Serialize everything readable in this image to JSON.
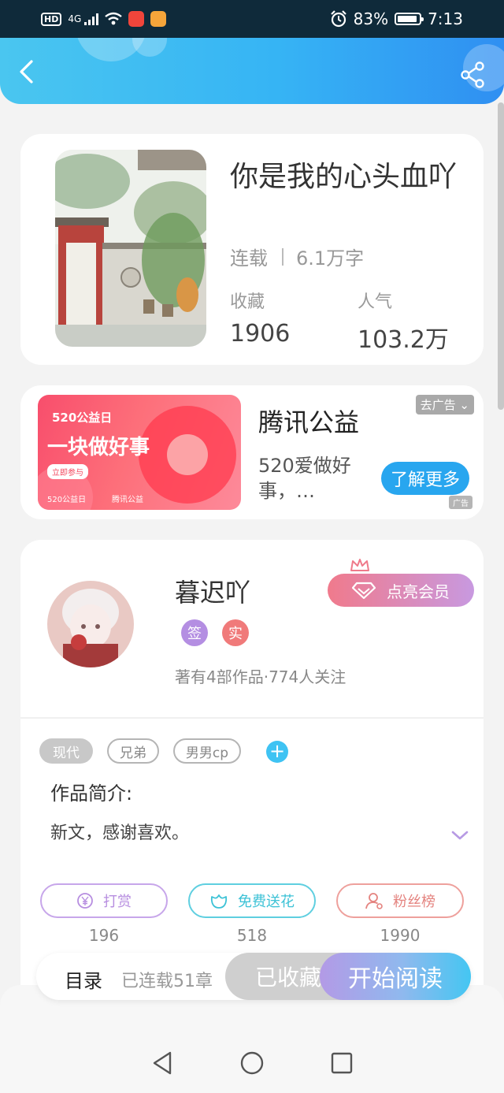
{
  "status_bar": {
    "network": "4G",
    "battery": "83%",
    "time": "7:13"
  },
  "book": {
    "title": "你是我的心头血吖",
    "status": "连载",
    "word_count": "6.1万字",
    "favorites_label": "收藏",
    "favorites_value": "1906",
    "popularity_label": "人气",
    "popularity_value": "103.2万"
  },
  "ad": {
    "banner_line1": "520公益日",
    "banner_line2": "一块做好事",
    "banner_btn": "立即参与",
    "banner_foot1": "520公益日",
    "banner_foot2": "腾讯公益",
    "title": "腾讯公益",
    "description": "520爱做好事，…",
    "close_label": "去广告",
    "cta_label": "了解更多",
    "ad_tag": "广告"
  },
  "author": {
    "name": "暮迟吖",
    "badge_sign": "签",
    "badge_real": "实",
    "stats": "著有4部作品·774人关注",
    "vip_label": "点亮会员"
  },
  "tags": [
    "现代",
    "兄弟",
    "男男cp"
  ],
  "intro": {
    "label": "作品简介:",
    "text": "新文，感谢喜欢。"
  },
  "actions": {
    "tip_label": "打赏",
    "tip_count": "196",
    "flower_label": "免费送花",
    "flower_count": "518",
    "fans_label": "粉丝榜",
    "fans_count": "1990"
  },
  "bottom_bar": {
    "catalog_label": "目录",
    "catalog_status": "已连载51章",
    "collected_label": "已收藏",
    "read_label": "开始阅读"
  },
  "colors": {
    "header_start": "#4ac6f0",
    "header_end": "#2f8ff2",
    "accent_blue": "#28a6ef",
    "tip_purple": "#b78ee0",
    "flower_cyan": "#3cc2d6",
    "fans_pink": "#e4837f"
  }
}
